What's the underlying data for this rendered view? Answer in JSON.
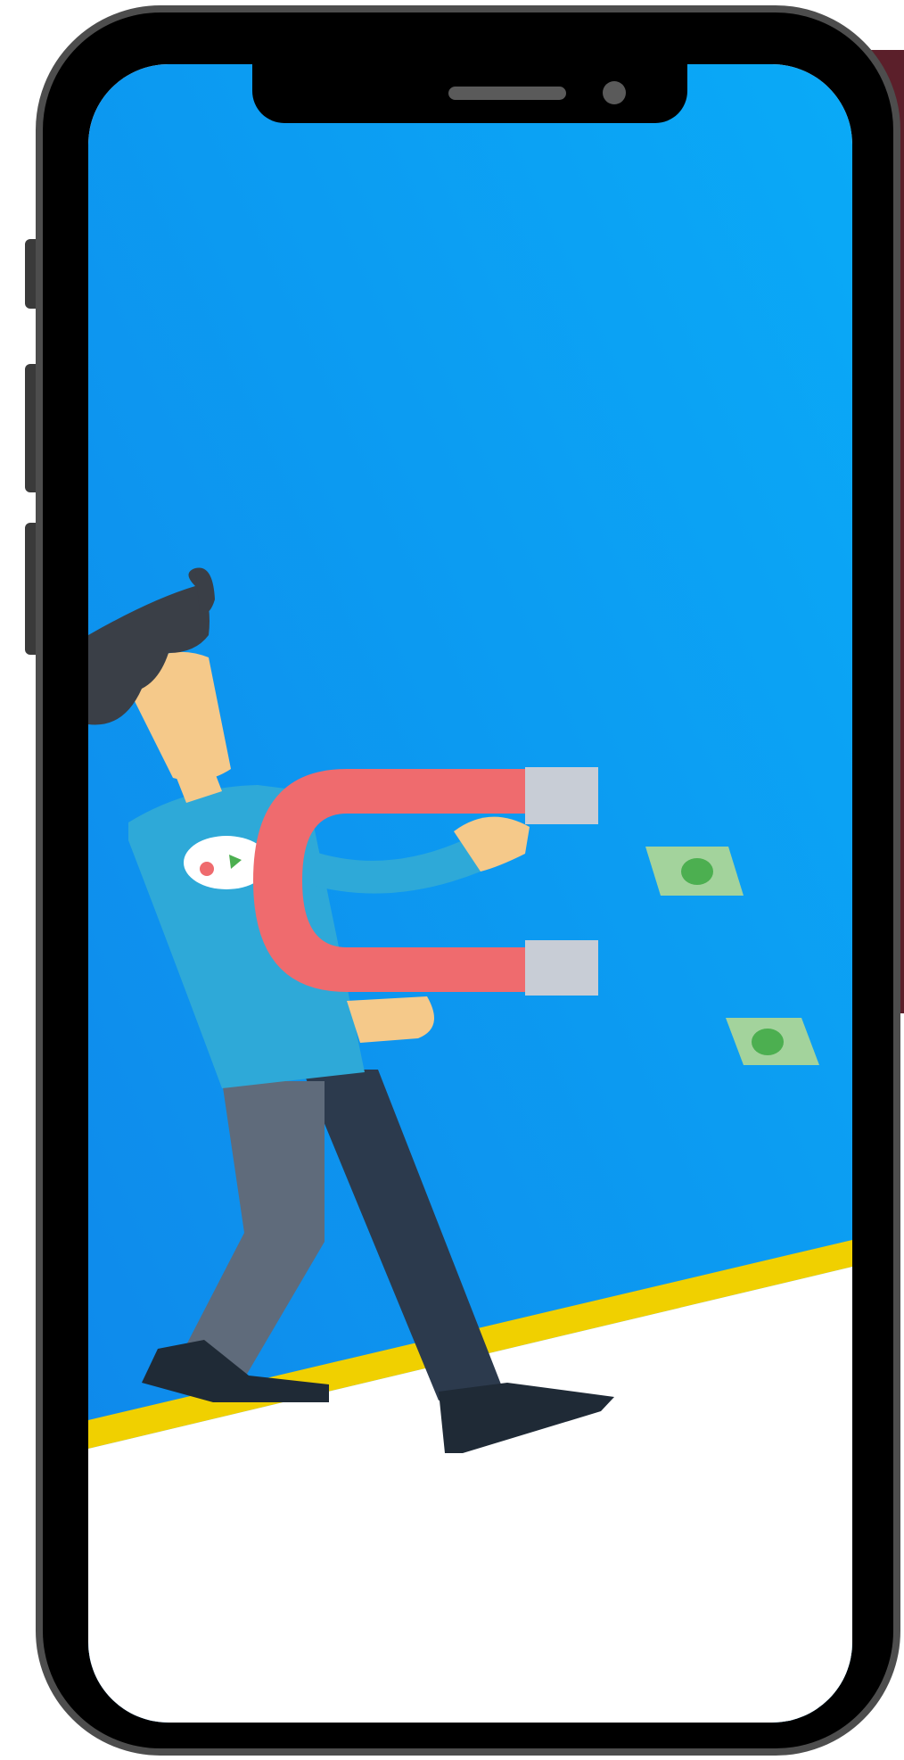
{
  "device": {
    "type": "smartphone-mockup",
    "frame_color": "#000000",
    "bezel_color": "#4d4d4d"
  },
  "illustration": {
    "subject": "person-with-magnet-attracting-money",
    "sky_gradient": [
      "#0f87ea",
      "#0aaaf7"
    ],
    "ground_color": "#ffffff",
    "ground_stripe_color": "#f0d000",
    "magnet_color": "#ef6b6e",
    "magnet_tip_color": "#c8cdd6",
    "shirt_color": "#2ea9d8",
    "banknote_color": "#a3d39c",
    "coin_color": "#4caf50"
  }
}
